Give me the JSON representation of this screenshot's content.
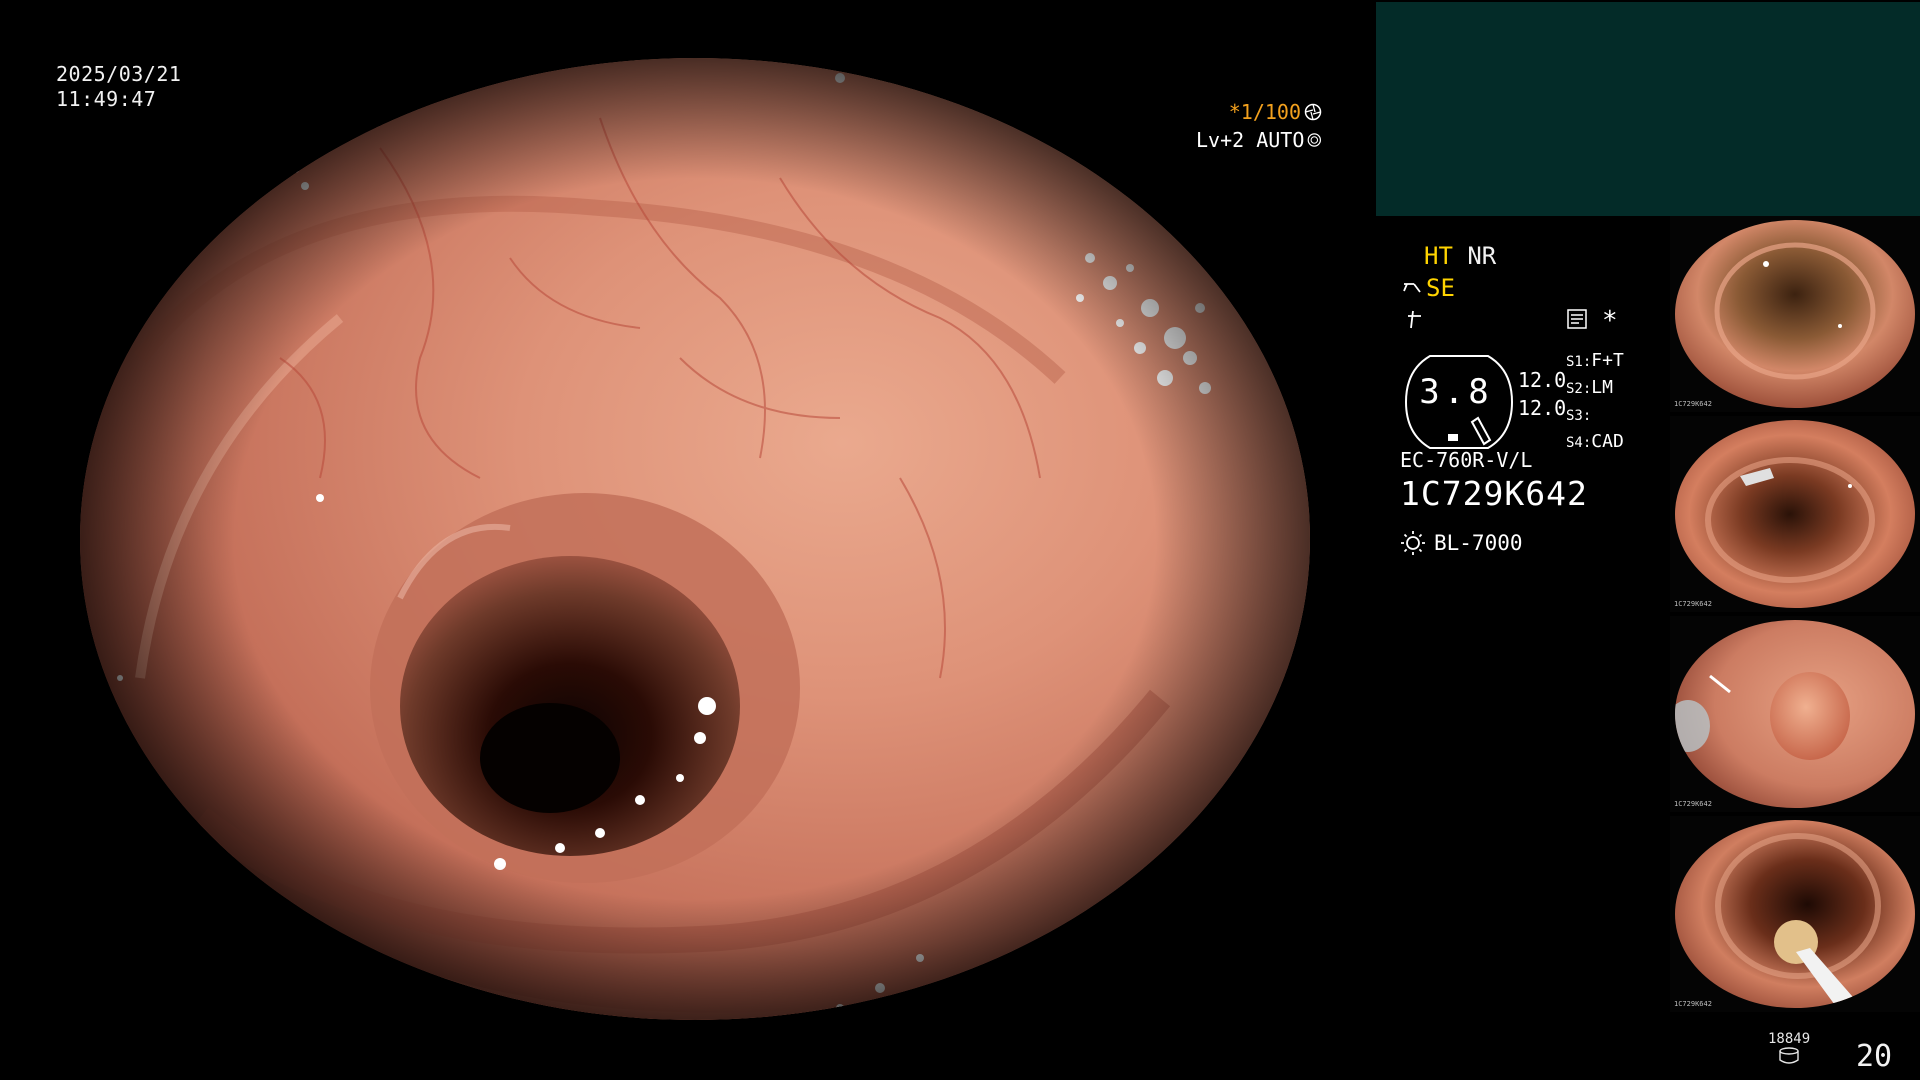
{
  "timestamp": {
    "date": "2025/03/21",
    "time": "11:49:47"
  },
  "capture": {
    "shutter": "*1/100",
    "shutter_icon": "aperture-icon",
    "level": "Lv+2 AUTO",
    "level_icon": "iris-icon"
  },
  "settings": {
    "ht": "HT",
    "nr": "NR",
    "enhance": "SE",
    "enhance_icon": "structure-enhance-icon",
    "freeze_icon": "freeze-icon",
    "memo_icon": "memo-icon",
    "asterisk": "*",
    "gauge_value": "3.8",
    "intensity": [
      "12.0",
      "12.0"
    ],
    "slots": [
      {
        "label": "S1:",
        "value": "F+T"
      },
      {
        "label": "S2:",
        "value": "LM"
      },
      {
        "label": "S3:",
        "value": ""
      },
      {
        "label": "S4:",
        "value": "CAD"
      }
    ],
    "scope_model": "EC-760R-V/L",
    "scope_serial": "1C729K642",
    "light_source": "BL-7000",
    "light_icon": "sun-icon"
  },
  "thumbnails": [
    {
      "serial": "1C729K642",
      "subject": "colon lumen"
    },
    {
      "serial": "1C729K642",
      "subject": "colon lumen with instrument"
    },
    {
      "serial": "1C729K642",
      "subject": "polyp"
    },
    {
      "serial": "1C729K642",
      "subject": "resection with snare"
    }
  ],
  "footer": {
    "image_count": "18849",
    "storage_icon": "storage-icon",
    "page_number": "20"
  },
  "colors": {
    "orange": "#f3a11e",
    "yellow": "#ffd400",
    "teal_panel": "#032b28",
    "mucosa": "#d98670"
  }
}
